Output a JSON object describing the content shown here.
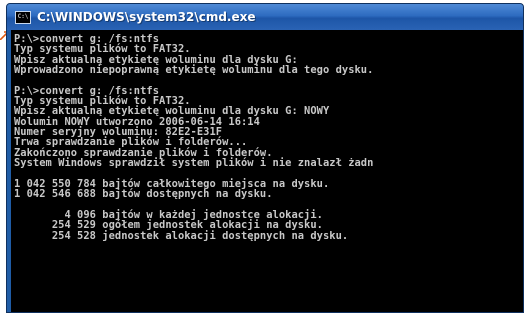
{
  "window": {
    "title": "C:\\WINDOWS\\system32\\cmd.exe",
    "icon": "cmd-console-icon",
    "icon_glyph": "C:\\"
  },
  "console": {
    "lines": [
      "P:\\>convert g: /fs:ntfs",
      "Typ systemu plików to FAT32.",
      "Wpisz aktualną etykietę woluminu dla dysku G:",
      "Wprowadzono niepoprawną etykietę woluminu dla tego dysku.",
      "",
      "P:\\>convert g: /fs:ntfs",
      "Typ systemu plików to FAT32.",
      "Wpisz aktualną etykietę woluminu dla dysku G: NOWY",
      "Wolumin NOWY utworzono 2006-06-14 16:14",
      "Numer seryjny woluminu: 82E2-E31F",
      "Trwa sprawdzanie plików i folderów...",
      "Zakończono sprawdzanie plików i folderów.",
      "System Windows sprawdził system plików i nie znalazł żadn",
      "",
      "1 042 550 784 bajtów całkowitego miejsca na dysku.",
      "1 042 546 688 bajtów dostępnych na dysku.",
      "",
      "        4 096 bajtów w każdej jednostce alokacji.",
      "      254 529 ogółem jednostek alokacji na dysku.",
      "      254 528 jednostek alokacji dostępnych na dysku."
    ]
  },
  "colors": {
    "console_text": "#c8c8c8",
    "console_bg": "#000000",
    "titlebar": "#2d6bc0",
    "pointer": "#e05a10"
  }
}
